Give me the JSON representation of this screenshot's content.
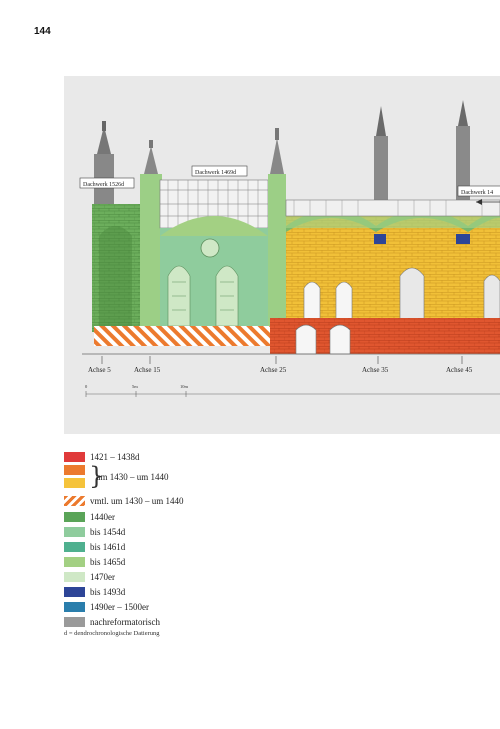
{
  "page": {
    "number": "144"
  },
  "figure": {
    "roof_labels": [
      {
        "id": "dw1",
        "text": "Dachwerk 1526d"
      },
      {
        "id": "dw2",
        "text": "Dachwerk 1469d"
      },
      {
        "id": "dw3",
        "text": "Dachwerk 14"
      }
    ],
    "axes": [
      "Achse 5",
      "Achse 15",
      "Achse 25",
      "Achse 35",
      "Achse 45"
    ],
    "scale": [
      "0",
      "5m",
      "10m"
    ]
  },
  "legend": {
    "items": [
      {
        "label": "1421 – 1438d",
        "color": "#e03a3a"
      },
      {
        "label": "um 1430 – um 1440",
        "color": "#ec7a2e",
        "color2": "#f5c33b"
      },
      {
        "label": "vmtl. um 1430 – um 1440",
        "color": "#ec7a2e",
        "pattern": "hatch"
      },
      {
        "label": "1440er",
        "color": "#5aa458"
      },
      {
        "label": "bis 1454d",
        "color": "#8fcc9d"
      },
      {
        "label": "bis 1461d",
        "color": "#4fb08f"
      },
      {
        "label": "bis 1465d",
        "color": "#a3d083"
      },
      {
        "label": "1470er",
        "color": "#cfe8c6"
      },
      {
        "label": "bis 1493d",
        "color": "#2d4597"
      },
      {
        "label": "1490er – 1500er",
        "color": "#2a7eac"
      },
      {
        "label": "nachreformatorisch",
        "color": "#9a9a9a"
      }
    ],
    "footnote": "d = dendrochronologische Datierung"
  }
}
